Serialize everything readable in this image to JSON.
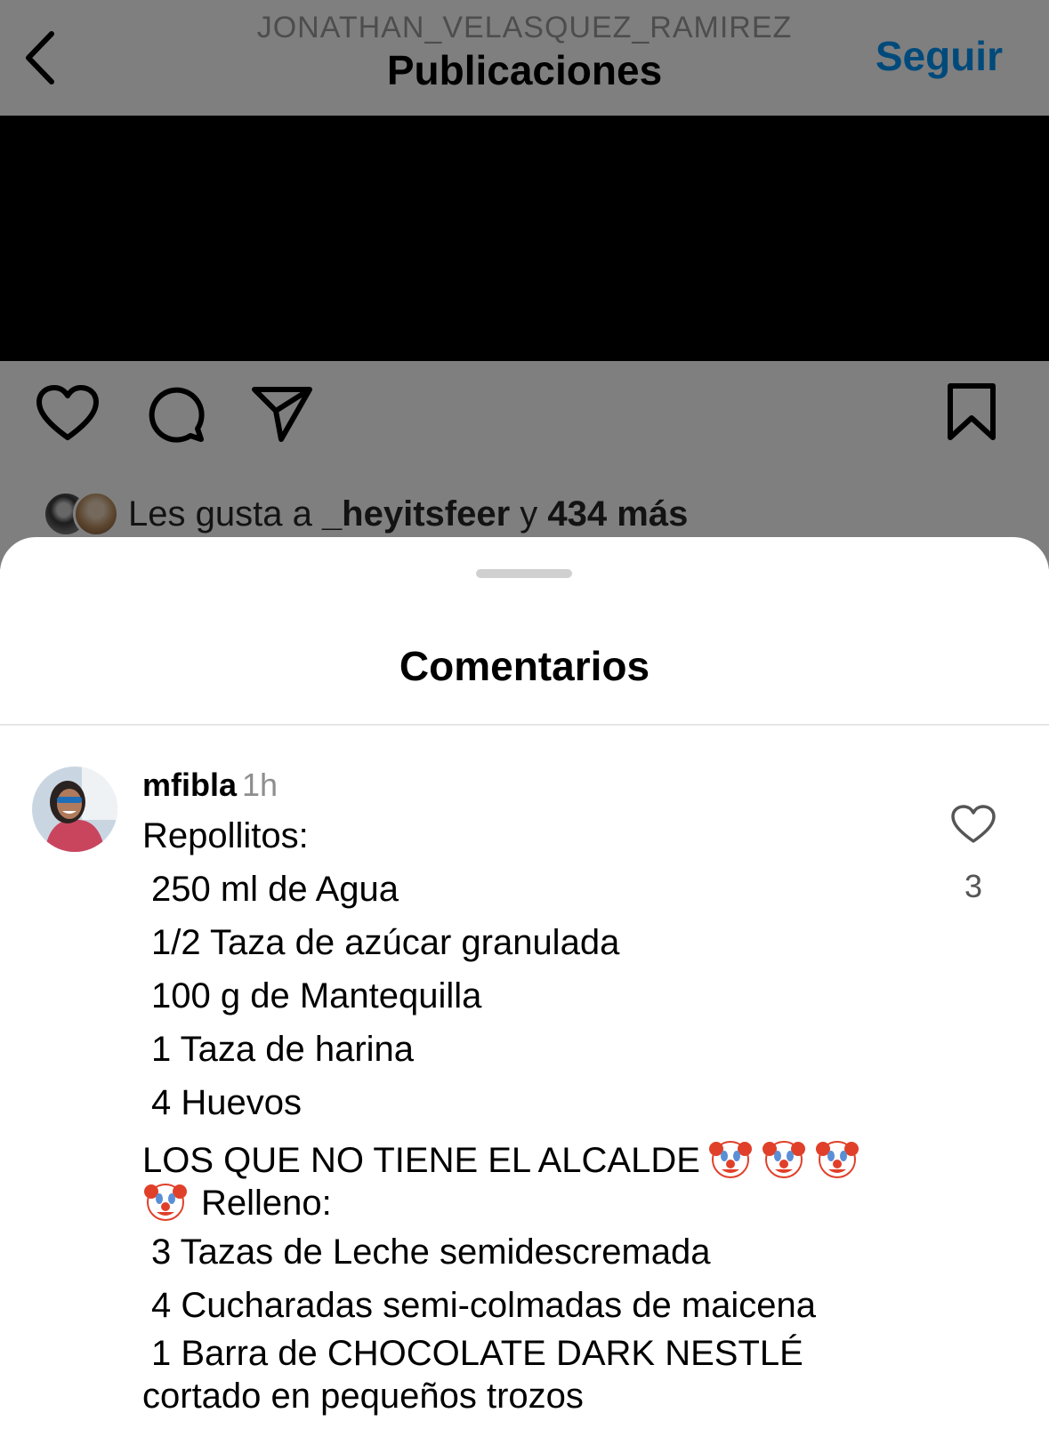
{
  "header": {
    "username": "JONATHAN_VELASQUEZ_RAMIREZ",
    "title": "Publicaciones",
    "follow_label": "Seguir"
  },
  "post": {
    "likes_prefix": "Les gusta a ",
    "likes_user": "_heyitsfeer",
    "likes_middle": " y ",
    "likes_count": "434 más"
  },
  "icons": [
    "back-icon",
    "mute-icon",
    "heart-icon",
    "comment-icon",
    "share-icon",
    "bookmark-icon",
    "clown-emoji"
  ],
  "colors": {
    "accent": "#0095f6",
    "overlay": "rgba(0,0,0,0.5)"
  },
  "comments_sheet": {
    "title": "Comentarios",
    "comment": {
      "username": "mfibla",
      "time": "1h",
      "like_count": "3",
      "lines": {
        "l1": "Repollitos:",
        "l2": "250 ml de Agua",
        "l3": "1/2 Taza de azúcar granulada",
        "l4": "100 g de Mantequilla",
        "l5": "1 Taza de harina",
        "l6": "4 Huevos",
        "l7": "LOS QUE NO TIENE EL ALCALDE",
        "l8": "Relleno:",
        "l9": "3 Tazas de Leche semidescremada",
        "l10": "4 Cucharadas semi-colmadas de maicena",
        "l11": "1 Barra de CHOCOLATE DARK NESTLÉ cortado en pequeños trozos"
      }
    }
  }
}
